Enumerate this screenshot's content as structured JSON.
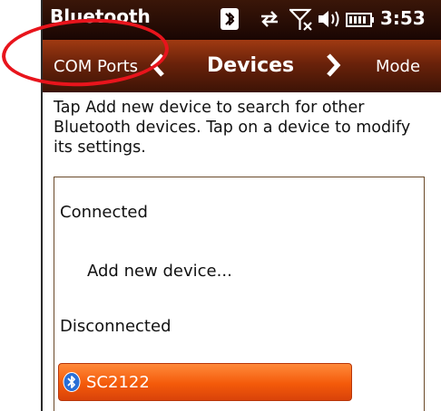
{
  "status_bar": {
    "title": "Bluetooth",
    "time": "3:53",
    "icons": [
      "bluetooth-icon",
      "sync-icon",
      "no-signal-icon",
      "speaker-icon",
      "battery-icon"
    ]
  },
  "tabs": {
    "prev_label": "COM Ports",
    "current_label": "Devices",
    "next_label": "Mode"
  },
  "description": "Tap Add new device to search for other Bluetooth devices. Tap on a device to modify its settings.",
  "list": {
    "connected_label": "Connected",
    "add_device_label": "Add new device...",
    "disconnected_label": "Disconnected",
    "devices": [
      {
        "name": "SC2122",
        "icon": "bluetooth-icon"
      }
    ]
  },
  "colors": {
    "accent": "#f45a0a",
    "header": "#6a220a",
    "annotation": "#e8141c"
  }
}
